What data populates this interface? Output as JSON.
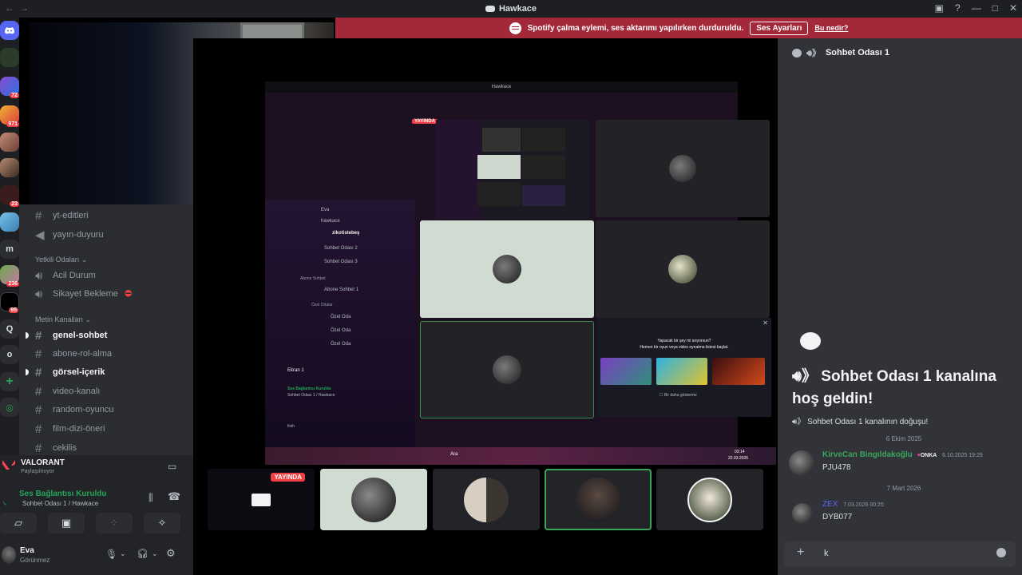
{
  "window": {
    "title": "Hawkace",
    "nav_back": "←",
    "nav_forward": "→",
    "controls": [
      "▣",
      "?",
      "—",
      "□",
      "✕"
    ]
  },
  "banner": {
    "message": "Spotify çalma eylemi, ses aktarımı yapılırken durduruldu.",
    "button": "Ses Ayarları",
    "link": "Bu nedir?"
  },
  "guilds": {
    "badges": [
      "72",
      "971",
      "23",
      "236",
      "95"
    ],
    "letters": [
      "m",
      "Q",
      "o"
    ]
  },
  "channels": {
    "items": [
      {
        "label": "yt-editleri",
        "type": "text"
      },
      {
        "label": "yayın-duyuru",
        "type": "announce"
      },
      {
        "label": "Acil Durum",
        "type": "voice"
      },
      {
        "label": "Sikayet Bekleme",
        "type": "voice"
      },
      {
        "label": "genel-sohbet",
        "type": "text"
      },
      {
        "label": "abone-rol-alma",
        "type": "text"
      },
      {
        "label": "görsel-içerik",
        "type": "text"
      },
      {
        "label": "video-kanalı",
        "type": "text"
      },
      {
        "label": "random-oyuncu",
        "type": "text"
      },
      {
        "label": "film-dizi-öneri",
        "type": "text"
      },
      {
        "label": "cekilis",
        "type": "text"
      }
    ],
    "category_yetkili": "Yetkili Odaları",
    "category_metin": "Metin Kanalları"
  },
  "activity": {
    "game": "VALORANT",
    "status": "Paylaşılmıyor"
  },
  "voice": {
    "status": "Ses Bağlantısı Kuruldu",
    "channel": "Sohbet Odası 1 / Hawkace"
  },
  "user": {
    "name": "Eva",
    "status": "Görünmez"
  },
  "stream": {
    "live_label": "YAYINDA"
  },
  "mini_screen": {
    "title": "Hawkace",
    "live_label": "YAYINDA",
    "channels": [
      "Eva",
      "hawkace",
      "zikotistebeş",
      "Sohbet Odası 2",
      "Sohbet Odası 3",
      "Abone Sohbet",
      "Abone Sohbet 1",
      "Özel Odalar",
      "Özel Oda",
      "Özel Oda",
      "Özel Oda"
    ],
    "screen_share": "Ekran 1",
    "voice_status": "Ses Bağlantısı Kuruldu",
    "voice_channel": "Sohbet Odası 1 / Hawkace",
    "user": "fixih",
    "dialog_line1": "Yapacak bir şey mi arıyorsun?",
    "dialog_line2": "Hemen bir oyun veya video oynatma listesi başlat.",
    "dialog_check": "Bir daha gösterme",
    "dialog_close": "✕",
    "clock_time": "03:14",
    "clock_date": "22.03.2026",
    "taskbar_search": "Ara"
  },
  "chat": {
    "header_icon": "speaker-icon",
    "channel_name": "Sohbet Odası 1",
    "welcome_title": "Sohbet Odası 1 kanalına hoş geldin!",
    "welcome_sub": "Sohbet Odası 1 kanalının doğuşu!",
    "messages": [
      {
        "divider": "6 Ekim 2025",
        "author": "KirveCan Bingıldakoğlu",
        "tag": "ONKA",
        "time": "6.10.2025 19:29",
        "text": "PJU478",
        "name_color": "#3ba55c"
      },
      {
        "divider": "7 Mart 2026",
        "author": "ZEX",
        "tag": "",
        "time": "7.03.2026 00:25",
        "text": "DYB077",
        "name_color": "#5865f2"
      }
    ],
    "composer_value": "k",
    "composer_plus": "+"
  },
  "colors": {
    "accent_red": "#f23f43",
    "banner_red": "#a3293a",
    "voice_green": "#23a55a",
    "sidebar_bg": "#2b2d31",
    "chat_bg": "#313338"
  }
}
